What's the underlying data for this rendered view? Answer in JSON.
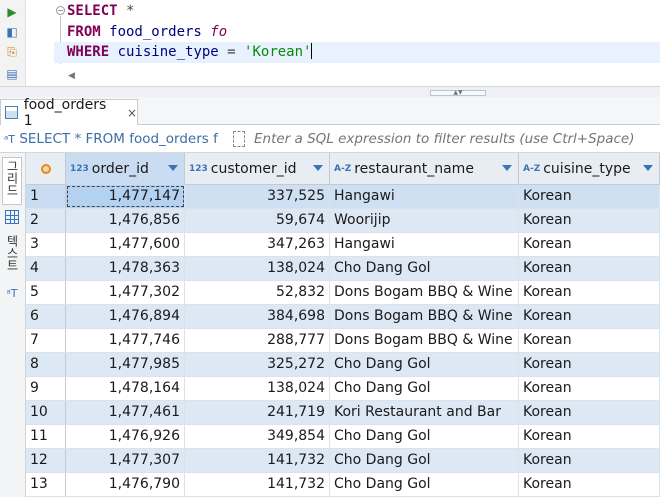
{
  "editor": {
    "lines": {
      "l1": {
        "kw": "SELECT",
        "rest": " *"
      },
      "l2": {
        "kw": "FROM",
        "table": " food_orders",
        "alias": " fo"
      },
      "l3": {
        "kw": "WHERE",
        "col": " cuisine_type",
        "op": " = ",
        "str": "'Korean'"
      }
    },
    "gutter_icons": [
      "run-icon",
      "explain-icon",
      "export-icon",
      "history-icon"
    ]
  },
  "results_tab": {
    "label": "food_orders 1",
    "close": "×"
  },
  "filter": {
    "query_text": "SELECT * FROM food_orders f",
    "placeholder": "Enter a SQL expression to filter results (use Ctrl+Space)"
  },
  "side_tabs": {
    "grid": "그리드",
    "text": "텍스트"
  },
  "grid": {
    "columns": [
      {
        "name": "order_id",
        "type": "123"
      },
      {
        "name": "customer_id",
        "type": "123"
      },
      {
        "name": "restaurant_name",
        "type": "A-Z"
      },
      {
        "name": "cuisine_type",
        "type": "A-Z"
      }
    ],
    "rows": [
      {
        "n": "1",
        "order_id": "1,477,147",
        "customer_id": "337,525",
        "restaurant_name": "Hangawi",
        "cuisine_type": "Korean"
      },
      {
        "n": "2",
        "order_id": "1,476,856",
        "customer_id": "59,674",
        "restaurant_name": "Woorijip",
        "cuisine_type": "Korean"
      },
      {
        "n": "3",
        "order_id": "1,477,600",
        "customer_id": "347,263",
        "restaurant_name": "Hangawi",
        "cuisine_type": "Korean"
      },
      {
        "n": "4",
        "order_id": "1,478,363",
        "customer_id": "138,024",
        "restaurant_name": "Cho Dang Gol",
        "cuisine_type": "Korean"
      },
      {
        "n": "5",
        "order_id": "1,477,302",
        "customer_id": "52,832",
        "restaurant_name": "Dons Bogam BBQ & Wine Bar",
        "cuisine_type": "Korean"
      },
      {
        "n": "6",
        "order_id": "1,476,894",
        "customer_id": "384,698",
        "restaurant_name": "Dons Bogam BBQ & Wine Bar",
        "cuisine_type": "Korean"
      },
      {
        "n": "7",
        "order_id": "1,477,746",
        "customer_id": "288,777",
        "restaurant_name": "Dons Bogam BBQ & Wine Bar",
        "cuisine_type": "Korean"
      },
      {
        "n": "8",
        "order_id": "1,477,985",
        "customer_id": "325,272",
        "restaurant_name": "Cho Dang Gol",
        "cuisine_type": "Korean"
      },
      {
        "n": "9",
        "order_id": "1,478,164",
        "customer_id": "138,024",
        "restaurant_name": "Cho Dang Gol",
        "cuisine_type": "Korean"
      },
      {
        "n": "10",
        "order_id": "1,477,461",
        "customer_id": "241,719",
        "restaurant_name": "Kori Restaurant and Bar",
        "cuisine_type": "Korean"
      },
      {
        "n": "11",
        "order_id": "1,476,926",
        "customer_id": "349,854",
        "restaurant_name": "Cho Dang Gol",
        "cuisine_type": "Korean"
      },
      {
        "n": "12",
        "order_id": "1,477,307",
        "customer_id": "141,732",
        "restaurant_name": "Cho Dang Gol",
        "cuisine_type": "Korean"
      },
      {
        "n": "13",
        "order_id": "1,476,790",
        "customer_id": "141,732",
        "restaurant_name": "Cho Dang Gol",
        "cuisine_type": "Korean"
      }
    ]
  }
}
